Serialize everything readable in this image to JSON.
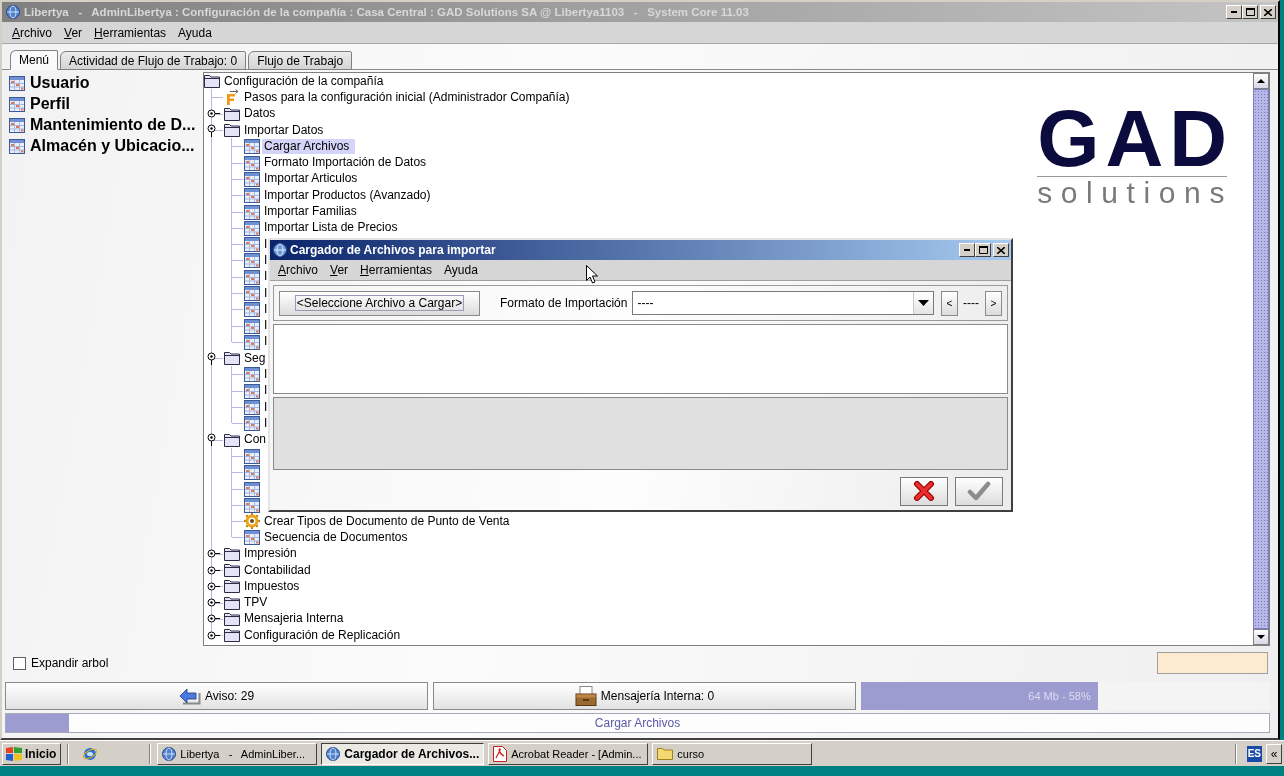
{
  "window": {
    "title": "Libertya   -   AdminLibertya : Configuración de la compañía : Casa Central : GAD Solutions SA @ Libertya1103   -   System Core 11.03",
    "active": false
  },
  "menu": [
    {
      "label": "Archivo",
      "mnemonic": true
    },
    {
      "label": "Ver",
      "mnemonic": true
    },
    {
      "label": "Herramientas",
      "mnemonic": true
    },
    {
      "label": "Ayuda",
      "mnemonic": false
    }
  ],
  "tabs": [
    {
      "label": "Menú",
      "selected": true
    },
    {
      "label": "Actividad de Flujo de Trabajo: 0",
      "selected": false
    },
    {
      "label": "Flujo de Trabajo",
      "selected": false
    }
  ],
  "sidebar": {
    "items": [
      {
        "label": "Usuario"
      },
      {
        "label": "Perfil"
      },
      {
        "label": "Mantenimiento de D..."
      },
      {
        "label": "Almacén y Ubicacio..."
      }
    ]
  },
  "tree": {
    "root": {
      "kind": "folder",
      "label": "Configuración de la compañía",
      "selected": false,
      "children": [
        {
          "kind": "workflow",
          "label": "Pasos para la configuración inicial (Administrador Compañía)",
          "selected": false
        },
        {
          "kind": "folder",
          "label": "Datos",
          "expanded": false,
          "selected": false
        },
        {
          "kind": "folder",
          "label": "Importar Datos",
          "expanded": true,
          "selected": false,
          "children": [
            {
              "kind": "window",
              "label": "Cargar Archivos",
              "selected": true
            },
            {
              "kind": "window",
              "label": "Formato Importación de Datos",
              "selected": false
            },
            {
              "kind": "window",
              "label": "Importar Articulos",
              "selected": false
            },
            {
              "kind": "window",
              "label": "Importar Productos (Avanzado)",
              "selected": false
            },
            {
              "kind": "window",
              "label": "Importar Familias",
              "selected": false
            },
            {
              "kind": "window",
              "label": "Importar Lista de Precios",
              "selected": false
            },
            {
              "kind": "window",
              "label": "I",
              "selected": false
            },
            {
              "kind": "window",
              "label": "I",
              "selected": false
            },
            {
              "kind": "window",
              "label": "I",
              "selected": false
            },
            {
              "kind": "window",
              "label": "I",
              "selected": false
            },
            {
              "kind": "window",
              "label": "I",
              "selected": false
            },
            {
              "kind": "window",
              "label": "I",
              "selected": false
            },
            {
              "kind": "window",
              "label": "I",
              "selected": false
            }
          ]
        },
        {
          "kind": "folder",
          "label": "Seg",
          "expanded": true,
          "selected": false,
          "children": [
            {
              "kind": "window",
              "label": "I",
              "selected": false
            },
            {
              "kind": "window",
              "label": "I",
              "selected": false
            },
            {
              "kind": "window",
              "label": "I",
              "selected": false
            },
            {
              "kind": "window",
              "label": "I",
              "selected": false
            }
          ]
        },
        {
          "kind": "folder",
          "label": "Con",
          "expanded": true,
          "selected": false,
          "children": [
            {
              "kind": "window",
              "selected": false
            },
            {
              "kind": "window",
              "selected": false
            },
            {
              "kind": "window",
              "selected": false
            },
            {
              "kind": "window",
              "selected": false
            },
            {
              "kind": "process",
              "label": "Crear Tipos de Documento de Punto de Venta",
              "selected": false
            },
            {
              "kind": "window",
              "label": "Secuencia de Documentos",
              "selected": false
            }
          ]
        },
        {
          "kind": "folder",
          "label": "Impresión",
          "expanded": false,
          "selected": false
        },
        {
          "kind": "folder",
          "label": "Contabilidad",
          "expanded": false,
          "selected": false
        },
        {
          "kind": "folder",
          "label": "Impuestos",
          "expanded": false,
          "selected": false
        },
        {
          "kind": "folder",
          "label": "TPV",
          "expanded": false,
          "selected": false
        },
        {
          "kind": "folder",
          "label": "Mensajeria Interna",
          "expanded": false,
          "selected": false
        },
        {
          "kind": "folder",
          "label": "Configuración de Replicación",
          "expanded": false,
          "selected": false
        }
      ]
    }
  },
  "logo": {
    "mark": "GAD",
    "tagline": "solutions"
  },
  "tree_options": {
    "expand_tree": {
      "label": "Expandir arbol",
      "checked": false
    }
  },
  "status": {
    "buttons": [
      {
        "kind": "notices",
        "label": "Aviso: 29"
      },
      {
        "kind": "messages",
        "label": "Mensajería Interna: 0"
      }
    ],
    "memory": {
      "level": 0.58,
      "reading": "64 Mb - 58%"
    },
    "status_line": {
      "level": 0.05,
      "text": "Cargar Archivos"
    }
  },
  "dialog": {
    "title": "Cargador de Archivos para importar",
    "active": true,
    "menu": [
      {
        "label": "Archivo",
        "mnemonic": true
      },
      {
        "label": "Ver",
        "mnemonic": true
      },
      {
        "label": "Herramientas",
        "mnemonic": true
      },
      {
        "label": "Ayuda",
        "mnemonic": false
      }
    ],
    "file_button": "<Seleccione Archivo a Cargar>",
    "format": {
      "label": "Formato de Importación",
      "value": "----"
    },
    "nav": {
      "prev": "<",
      "position": "----",
      "next": ">"
    },
    "actions": [
      {
        "kind": "cancel",
        "disabled": false
      },
      {
        "kind": "ok",
        "disabled": true
      }
    ]
  },
  "taskbar": {
    "start": "Inicio",
    "tasks": [
      {
        "kind": "app",
        "label": "Libertya   -   AdminLiber...",
        "selected": false
      },
      {
        "kind": "app",
        "label": "Cargador de Archivos...",
        "selected": true
      },
      {
        "kind": "pdf",
        "label": "Acrobat Reader - [Admin...",
        "selected": false
      },
      {
        "kind": "folder",
        "label": "curso",
        "selected": false
      }
    ],
    "tray": {
      "language": "ES",
      "expand": "«"
    }
  }
}
